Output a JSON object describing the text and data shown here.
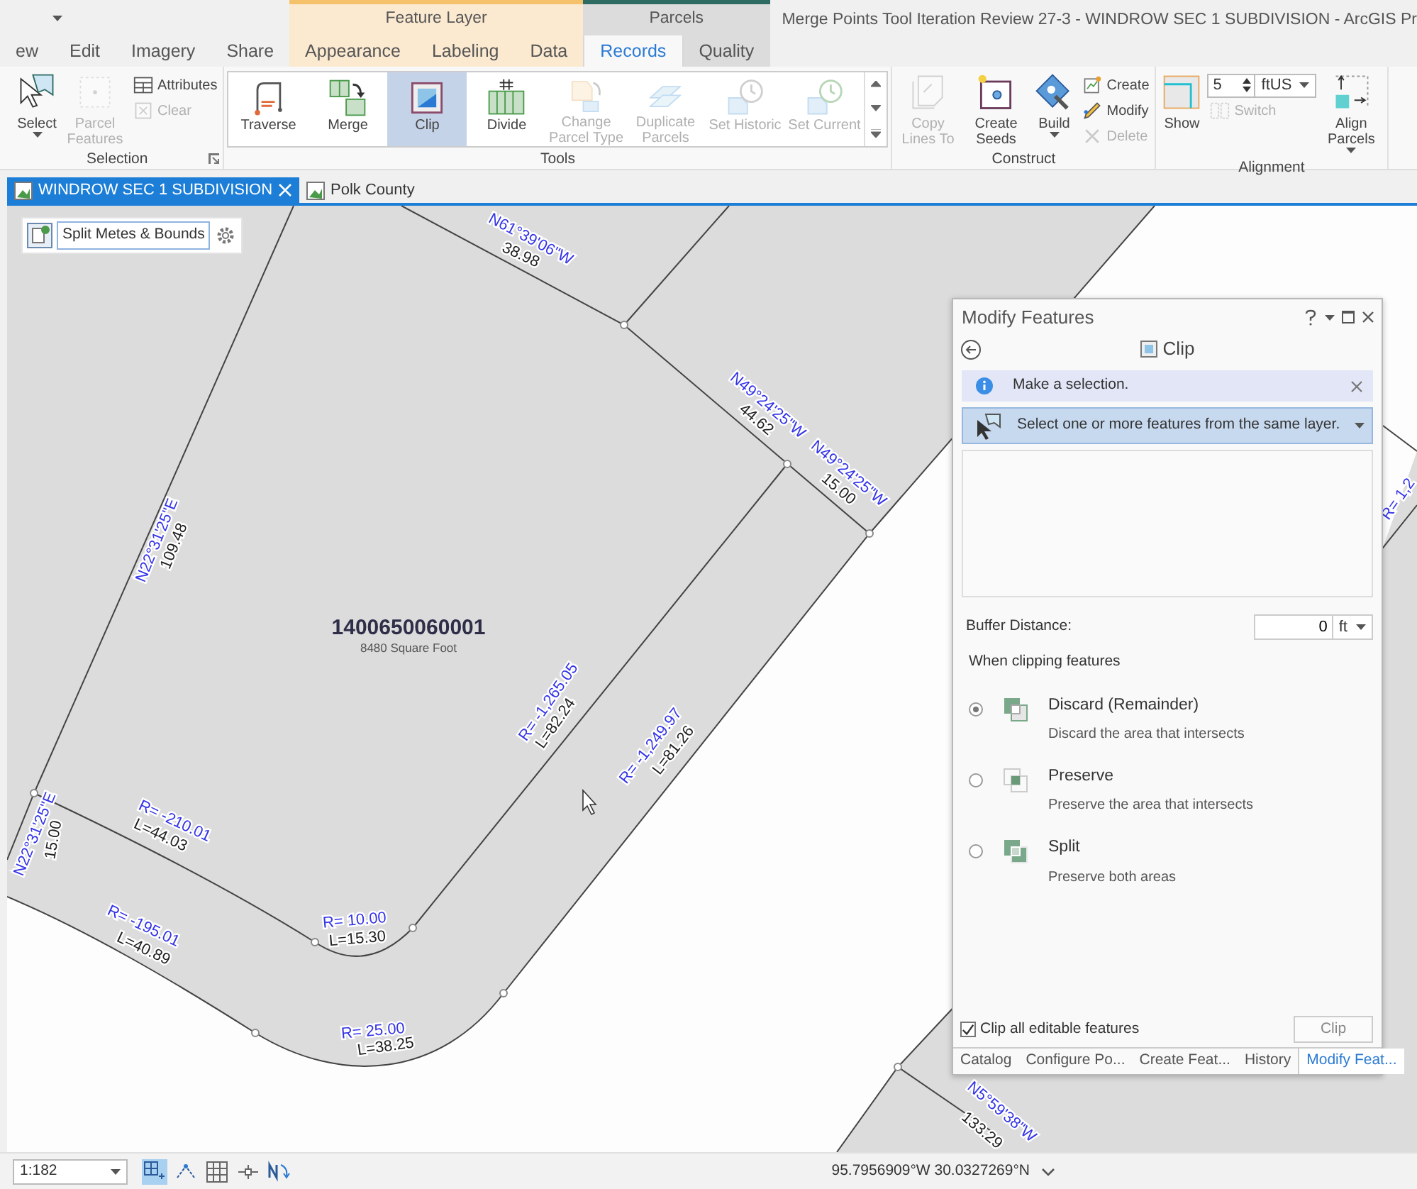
{
  "window": {
    "title": "Merge Points Tool Iteration Review 27-3 - WINDROW SEC 1 SUBDIVISION - ArcGIS Pr"
  },
  "ribbon_tabs": [
    {
      "label": "ew",
      "selected": false
    },
    {
      "label": "Edit",
      "selected": false
    },
    {
      "label": "Imagery",
      "selected": false
    },
    {
      "label": "Share",
      "selected": false
    }
  ],
  "contexts": [
    {
      "label": "Feature Layer",
      "color": "#f5c26b",
      "tabs": [
        {
          "label": "Appearance",
          "selected": false
        },
        {
          "label": "Labeling",
          "selected": false
        },
        {
          "label": "Data",
          "selected": false
        }
      ]
    },
    {
      "label": "Parcels",
      "color": "#2e6b62",
      "tabs": [
        {
          "label": "Records",
          "selected": true
        },
        {
          "label": "Quality",
          "selected": false
        }
      ]
    }
  ],
  "ribbon_groups": [
    {
      "label": "Selection",
      "kind": "plain",
      "launcher": true,
      "items": [
        {
          "kind": "large",
          "label": "Select",
          "caret": true,
          "disabled": false
        },
        {
          "kind": "large",
          "label": "Parcel Features",
          "disabled": true
        },
        {
          "kind": "small",
          "label": "Attributes",
          "disabled": false
        },
        {
          "kind": "small",
          "label": "Clear",
          "disabled": true
        }
      ]
    },
    {
      "label": "Tools",
      "kind": "gallery",
      "items": [
        {
          "kind": "gallery",
          "label": "Traverse",
          "selected": false,
          "disabled": false
        },
        {
          "kind": "gallery",
          "label": "Merge",
          "selected": false,
          "disabled": false
        },
        {
          "kind": "gallery",
          "label": "Clip",
          "selected": true,
          "disabled": false
        },
        {
          "kind": "gallery",
          "label": "Divide",
          "selected": false,
          "disabled": false
        },
        {
          "kind": "gallery",
          "label": "Change Parcel Type",
          "selected": false,
          "disabled": true
        },
        {
          "kind": "gallery",
          "label": "Duplicate Parcels",
          "selected": false,
          "disabled": true
        },
        {
          "kind": "gallery",
          "label": "Set Historic",
          "selected": false,
          "disabled": true
        },
        {
          "kind": "gallery",
          "label": "Set Current",
          "selected": false,
          "disabled": true
        }
      ]
    },
    {
      "label": "Construct",
      "kind": "plain",
      "items": [
        {
          "kind": "large",
          "label": "Copy Lines To",
          "disabled": true
        },
        {
          "kind": "large",
          "label": "Create Seeds",
          "disabled": false
        },
        {
          "kind": "large",
          "label": "Build",
          "caret": true,
          "disabled": false
        },
        {
          "kind": "small",
          "label": "Create",
          "disabled": false
        },
        {
          "kind": "small",
          "label": "Modify",
          "disabled": false
        },
        {
          "kind": "small",
          "label": "Delete",
          "disabled": true
        }
      ]
    },
    {
      "label": "Alignment",
      "kind": "plain",
      "items": [
        {
          "kind": "large",
          "label": "Show",
          "disabled": false
        },
        {
          "kind": "spinner",
          "value": "5",
          "unit": "ftUS"
        },
        {
          "kind": "small",
          "label": "Switch",
          "disabled": true
        },
        {
          "kind": "large",
          "label": "Align Parcels",
          "caret": true,
          "disabled": false
        }
      ]
    }
  ],
  "map_tabs": [
    {
      "label": "WINDROW SEC 1 SUBDIVISION",
      "selected": true
    },
    {
      "label": "Polk County",
      "selected": false
    }
  ],
  "map": {
    "template": "Split Metes & Bounds",
    "labels": [
      {
        "text": "N61°39'06\"W",
        "kind": "bearing"
      },
      {
        "text": "38.98",
        "kind": "distance"
      },
      {
        "text": "N49°24'25\"W",
        "kind": "bearing"
      },
      {
        "text": "44.62",
        "kind": "distance"
      },
      {
        "text": "N49°24'25\"W",
        "kind": "bearing"
      },
      {
        "text": "15.00",
        "kind": "distance"
      },
      {
        "text": "N22°31'25\"E",
        "kind": "bearing"
      },
      {
        "text": "109.48",
        "kind": "distance"
      },
      {
        "text": "1400650060001",
        "kind": "parcel_id"
      },
      {
        "text": "8480 Square Foot",
        "kind": "area"
      },
      {
        "text": "R= -1,265.05",
        "kind": "bearing"
      },
      {
        "text": "L=82.24",
        "kind": "distance"
      },
      {
        "text": "R= -1,249.97",
        "kind": "bearing"
      },
      {
        "text": "L=81.26",
        "kind": "distance"
      },
      {
        "text": "N22°31'25\"E",
        "kind": "bearing"
      },
      {
        "text": "15.00",
        "kind": "distance"
      },
      {
        "text": "R= -210.01",
        "kind": "bearing"
      },
      {
        "text": "L=44.03",
        "kind": "distance"
      },
      {
        "text": "R= 10.00",
        "kind": "bearing"
      },
      {
        "text": "L=15.30",
        "kind": "distance"
      },
      {
        "text": "R= -195.01",
        "kind": "bearing"
      },
      {
        "text": "L=40.89",
        "kind": "distance"
      },
      {
        "text": "R= 25.00",
        "kind": "bearing"
      },
      {
        "text": "L=38.25",
        "kind": "distance"
      },
      {
        "text": "N5°59'38\"W",
        "kind": "bearing"
      },
      {
        "text": "133.29",
        "kind": "distance"
      },
      {
        "text": "R= 1,2",
        "kind": "bearing"
      }
    ]
  },
  "pane": {
    "title": "Modify Features",
    "tool": "Clip",
    "message": "Make a selection.",
    "selection_prompt": "Select one or more features from the same layer.",
    "buffer": {
      "label": "Buffer Distance:",
      "value": "0",
      "unit": "ft"
    },
    "section_label": "When clipping features",
    "options": [
      {
        "kind": "discard",
        "title": "Discard (Remainder)",
        "description": "Discard the area that intersects",
        "selected": true
      },
      {
        "kind": "preserve",
        "title": "Preserve",
        "description": "Preserve the area that intersects",
        "selected": false
      },
      {
        "kind": "split",
        "title": "Split",
        "description": "Preserve both areas",
        "selected": false
      }
    ],
    "clip_all": {
      "label": "Clip all editable features",
      "checked": true
    },
    "action": {
      "label": "Clip",
      "disabled": true
    },
    "tabs": [
      {
        "label": "Catalog",
        "selected": false
      },
      {
        "label": "Configure Po...",
        "selected": false
      },
      {
        "label": "Create Feat...",
        "selected": false
      },
      {
        "label": "History",
        "selected": false
      },
      {
        "label": "Modify Feat...",
        "selected": true
      }
    ]
  },
  "status_bar": {
    "scale": "1:182",
    "tools": [
      {
        "selected": true
      },
      {
        "selected": false
      },
      {
        "selected": false
      },
      {
        "selected": false
      },
      {
        "selected": false
      }
    ],
    "coordinates": "95.7956909°W 30.0327269°N"
  }
}
